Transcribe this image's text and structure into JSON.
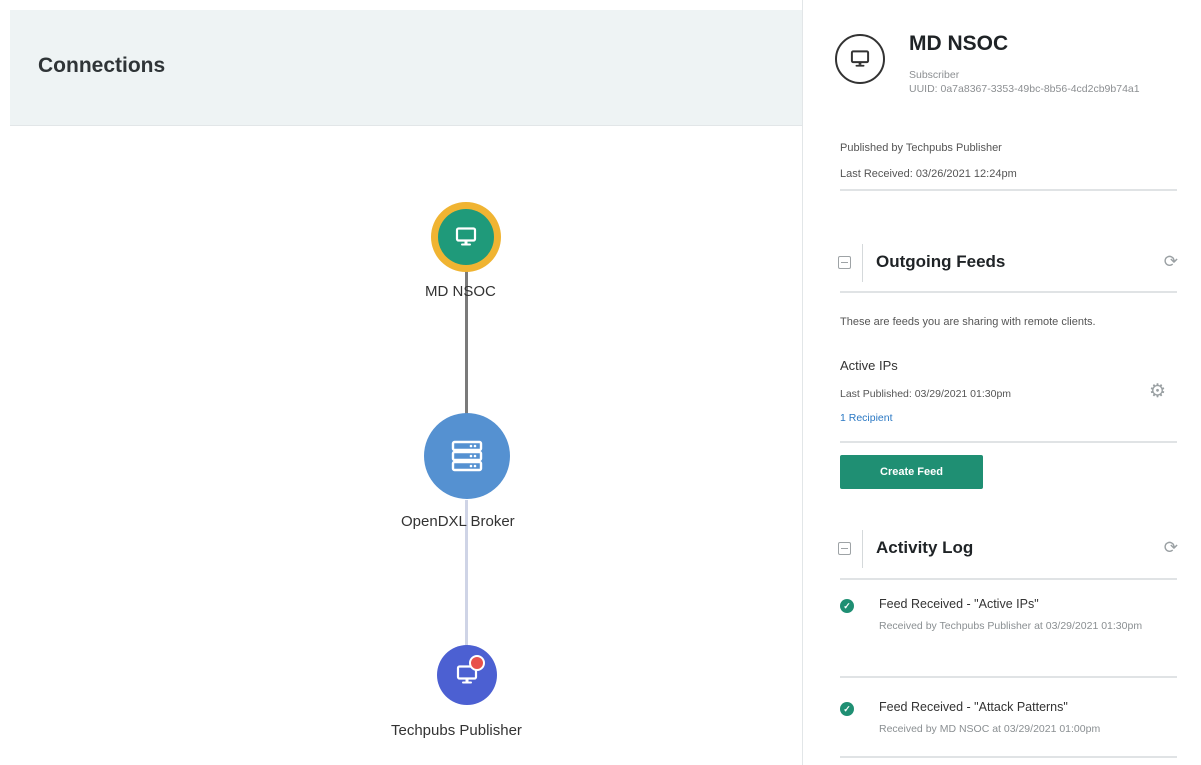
{
  "left": {
    "title": "Connections",
    "nodes": {
      "nsoc": "MD NSOC",
      "broker": "OpenDXL Broker",
      "publisher": "Techpubs Publisher"
    }
  },
  "panel": {
    "title": "MD NSOC",
    "subtitle": "Subscriber",
    "uuid": "UUID: 0a7a8367-3353-49bc-8b56-4cd2cb9b74a1",
    "published_by": "Published by Techpubs Publisher",
    "last_received": "Last Received: 03/26/2021 12:24pm",
    "outgoing": {
      "title": "Outgoing Feeds",
      "description": "These are feeds you are sharing with remote clients.",
      "feed_name": "Active IPs",
      "last_published": "Last Published: 03/29/2021 01:30pm",
      "recipients": "1 Recipient",
      "create_label": "Create Feed"
    },
    "activity": {
      "title": "Activity Log",
      "items": [
        {
          "title": "Feed Received - \"Active IPs\"",
          "detail": "Received by Techpubs Publisher at 03/29/2021 01:30pm"
        },
        {
          "title": "Feed Received - \"Attack Patterns\"",
          "detail": "Received by MD NSOC at 03/29/2021 01:00pm"
        }
      ]
    }
  },
  "colors": {
    "accent_green": "#1f8f73",
    "node_nsoc": "#1f9a7a",
    "node_ring": "#f0b432",
    "node_broker": "#5591d1",
    "node_publisher": "#4c60d2",
    "link": "#2a78c4"
  },
  "icons": {
    "nsoc": "monitor-icon",
    "broker": "server-icon",
    "publisher": "monitor-alert-icon",
    "refresh": "refresh-icon",
    "settings": "gear-icon",
    "status": "check-circle-icon"
  }
}
